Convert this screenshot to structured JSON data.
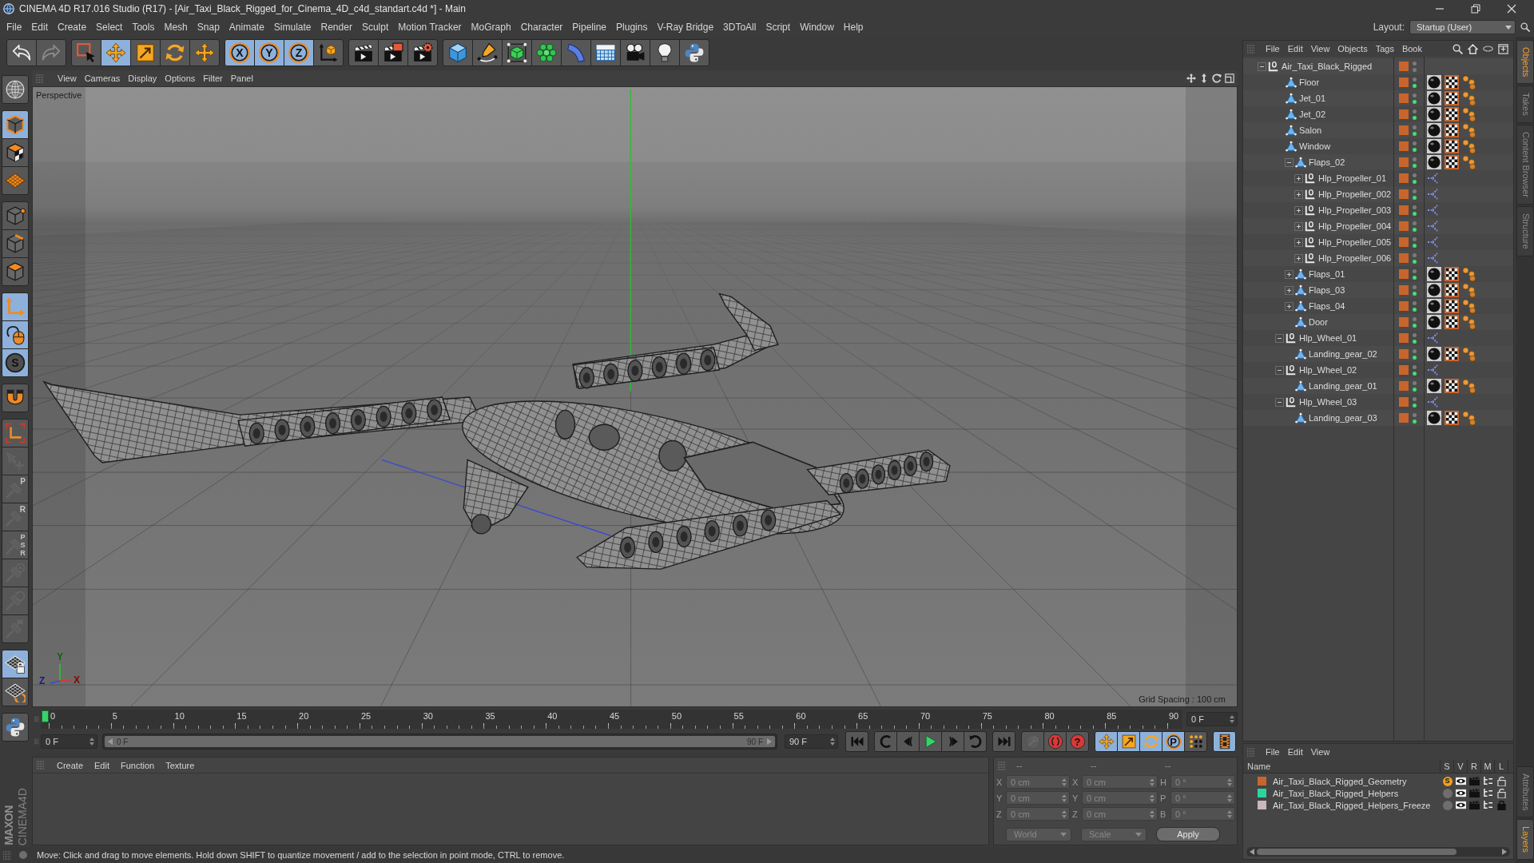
{
  "window": {
    "title": "CINEMA 4D R17.016 Studio (R17) - [Air_Taxi_Black_Rigged_for_Cinema_4D_c4d_standart.c4d *] - Main"
  },
  "menu_bar": [
    "File",
    "Edit",
    "Create",
    "Select",
    "Tools",
    "Mesh",
    "Snap",
    "Animate",
    "Simulate",
    "Render",
    "Sculpt",
    "Motion Tracker",
    "MoGraph",
    "Character",
    "Pipeline",
    "Plugins",
    "V-Ray Bridge",
    "3DToAll",
    "Script",
    "Window",
    "Help"
  ],
  "layout": {
    "label": "Layout:",
    "value": "Startup (User)"
  },
  "toolbar": [
    [
      {
        "selected": false,
        "disabled": false
      },
      {
        "selected": false,
        "disabled": true
      }
    ],
    [
      {
        "selected": false,
        "disabled": false
      },
      {
        "selected": true,
        "disabled": false
      },
      {
        "selected": false,
        "disabled": false
      },
      {
        "selected": false,
        "disabled": false
      },
      {
        "selected": false,
        "disabled": false
      }
    ],
    [
      {
        "label": "X",
        "selected": true,
        "disabled": false
      },
      {
        "label": "Y",
        "selected": true,
        "disabled": false
      },
      {
        "label": "Z",
        "selected": true,
        "disabled": false
      },
      {
        "selected": false,
        "disabled": false
      }
    ],
    [
      {
        "selected": false,
        "disabled": false
      },
      {
        "selected": false,
        "disabled": false
      },
      {
        "selected": false,
        "disabled": false
      }
    ],
    [
      {
        "selected": false,
        "disabled": false
      },
      {
        "selected": false,
        "disabled": false
      },
      {
        "selected": false,
        "disabled": false
      },
      {
        "selected": false,
        "disabled": false
      },
      {
        "selected": false,
        "disabled": false
      },
      {
        "selected": false,
        "disabled": false
      },
      {
        "selected": false,
        "disabled": false
      },
      {
        "selected": false,
        "disabled": false
      },
      {
        "selected": false,
        "disabled": false
      }
    ]
  ],
  "left_toolbar": [
    [
      {
        "selected": false,
        "disabled": false
      }
    ],
    [
      {
        "selected": true,
        "disabled": false
      },
      {
        "selected": false,
        "disabled": false
      },
      {
        "selected": false,
        "disabled": false
      }
    ],
    [
      {
        "selected": false,
        "disabled": false
      },
      {
        "selected": false,
        "disabled": false
      },
      {
        "selected": false,
        "disabled": false
      }
    ],
    [
      {
        "selected": true,
        "disabled": false
      },
      {
        "selected": true,
        "disabled": false
      },
      {
        "label": "S",
        "selected": true,
        "disabled": false
      }
    ],
    [
      {
        "selected": false,
        "disabled": false
      }
    ],
    [
      {
        "selected": false,
        "disabled": false
      },
      {
        "selected": false,
        "disabled": true
      },
      {
        "label": "P",
        "selected": false,
        "disabled": true
      },
      {
        "label": "R",
        "selected": false,
        "disabled": true
      },
      {
        "label": "PSR",
        "selected": false,
        "disabled": true
      },
      {
        "selected": false,
        "disabled": true
      },
      {
        "selected": false,
        "disabled": true
      },
      {
        "selected": false,
        "disabled": true
      }
    ],
    [
      {
        "selected": true,
        "disabled": false
      },
      {
        "selected": false,
        "disabled": false
      }
    ],
    [
      {
        "selected": false,
        "disabled": false
      }
    ]
  ],
  "viewport": {
    "menu": [
      "View",
      "Cameras",
      "Display",
      "Options",
      "Filter",
      "Panel"
    ],
    "camera": "Perspective",
    "axis_labels": [
      "Y",
      "Z",
      "X"
    ],
    "grid_spacing": "Grid Spacing : 100 cm"
  },
  "timeline": {
    "ticks": [
      "0",
      "5",
      "10",
      "15",
      "20",
      "25",
      "30",
      "35",
      "40",
      "45",
      "50",
      "55",
      "60",
      "65",
      "70",
      "75",
      "80",
      "85",
      "90"
    ],
    "level": 0,
    "current_frame": "0 F"
  },
  "transport": {
    "start_frame": "0 F",
    "range": {
      "start": "0 F",
      "end": "90 F",
      "level": 1
    },
    "end_frame": "90 F",
    "buttons": [
      [
        {
          "selected": false,
          "disabled": false
        }
      ],
      [
        {
          "selected": false,
          "disabled": false
        },
        {
          "selected": false,
          "disabled": false
        },
        {
          "selected": false,
          "disabled": false
        },
        {
          "selected": false,
          "disabled": false
        },
        {
          "selected": false,
          "disabled": false
        }
      ],
      [
        {
          "selected": false,
          "disabled": false
        }
      ],
      [
        {
          "selected": false,
          "disabled": true
        },
        {
          "selected": false,
          "disabled": false
        },
        {
          "label": "?",
          "selected": false,
          "disabled": false
        }
      ],
      [
        {
          "selected": true,
          "disabled": false
        },
        {
          "selected": true,
          "disabled": false
        },
        {
          "selected": true,
          "disabled": false
        },
        {
          "label": "P",
          "selected": true,
          "disabled": false
        },
        {
          "selected": false,
          "disabled": false
        }
      ],
      [
        {
          "selected": true,
          "disabled": false
        }
      ]
    ]
  },
  "material_manager": {
    "menu": [
      "Create",
      "Edit",
      "Function",
      "Texture"
    ]
  },
  "coordinates": {
    "disabled": true,
    "headers": [
      "--",
      "--",
      "--"
    ],
    "rows": [
      {
        "position_axis": "X",
        "position": "0 cm",
        "size_axis": "X",
        "size": "0 cm",
        "rotation_axis": "H",
        "rotation": "0 °"
      },
      {
        "position_axis": "Y",
        "position": "0 cm",
        "size_axis": "Y",
        "size": "0 cm",
        "rotation_axis": "P",
        "rotation": "0 °"
      },
      {
        "position_axis": "Z",
        "position": "0 cm",
        "size_axis": "Z",
        "size": "0 cm",
        "rotation_axis": "B",
        "rotation": "0 °"
      }
    ],
    "position_mode": "World",
    "size_mode": "Scale",
    "apply": "Apply"
  },
  "status_bar": {
    "message": "Move: Click and drag to move elements. Hold down SHIFT to quantize movement / add to the selection in point mode, CTRL to remove."
  },
  "object_manager": {
    "menu": [
      "File",
      "Edit",
      "View",
      "Objects",
      "Tags",
      "Book"
    ],
    "objects": [
      {
        "name": "Air_Taxi_Black_Rigged",
        "kind": "null",
        "expanded": true,
        "render_visible": false,
        "children": [
          {
            "name": "Floor",
            "kind": "mesh",
            "render_visible": true
          },
          {
            "name": "Jet_01",
            "kind": "mesh",
            "render_visible": true
          },
          {
            "name": "Jet_02",
            "kind": "mesh",
            "render_visible": true
          },
          {
            "name": "Salon",
            "kind": "mesh",
            "render_visible": true
          },
          {
            "name": "Window",
            "kind": "mesh",
            "render_visible": true,
            "children": [
              {
                "name": "Flaps_02",
                "kind": "mesh",
                "expanded": true,
                "render_visible": true,
                "children": [
                  {
                    "name": "Hlp_Propeller_01",
                    "kind": "helper",
                    "expanded": false,
                    "render_visible": true
                  },
                  {
                    "name": "Hlp_Propeller_002",
                    "kind": "helper",
                    "expanded": false,
                    "render_visible": true
                  },
                  {
                    "name": "Hlp_Propeller_003",
                    "kind": "helper",
                    "expanded": false,
                    "render_visible": true
                  },
                  {
                    "name": "Hlp_Propeller_004",
                    "kind": "helper",
                    "expanded": false,
                    "render_visible": true
                  },
                  {
                    "name": "Hlp_Propeller_005",
                    "kind": "helper",
                    "expanded": false,
                    "render_visible": true
                  },
                  {
                    "name": "Hlp_Propeller_006",
                    "kind": "helper",
                    "expanded": false,
                    "render_visible": true
                  }
                ]
              },
              {
                "name": "Flaps_01",
                "kind": "mesh",
                "expanded": false,
                "render_visible": true
              },
              {
                "name": "Flaps_03",
                "kind": "mesh",
                "expanded": false,
                "render_visible": true
              },
              {
                "name": "Flaps_04",
                "kind": "mesh",
                "expanded": false,
                "render_visible": true
              },
              {
                "name": "Door",
                "kind": "mesh",
                "render_visible": true
              }
            ]
          },
          {
            "name": "Hlp_Wheel_01",
            "kind": "helper",
            "expanded": true,
            "render_visible": true,
            "children": [
              {
                "name": "Landing_gear_02",
                "kind": "mesh",
                "render_visible": true
              }
            ]
          },
          {
            "name": "Hlp_Wheel_02",
            "kind": "helper",
            "expanded": true,
            "render_visible": true,
            "children": [
              {
                "name": "Landing_gear_01",
                "kind": "mesh",
                "render_visible": true
              }
            ]
          },
          {
            "name": "Hlp_Wheel_03",
            "kind": "helper",
            "expanded": true,
            "render_visible": true,
            "children": [
              {
                "name": "Landing_gear_03",
                "kind": "mesh",
                "render_visible": true
              }
            ]
          }
        ]
      }
    ]
  },
  "layer_manager": {
    "menu": [
      "File",
      "Edit",
      "View"
    ],
    "columns": [
      "Name",
      "S",
      "V",
      "R",
      "M",
      "L"
    ],
    "layers": [
      {
        "name": "Air_Taxi_Black_Rigged_Geometry",
        "color": "#c8652c",
        "solo": true,
        "solo_mark": "S",
        "visible": true,
        "render": true,
        "manager": true,
        "locked": false
      },
      {
        "name": "Air_Taxi_Black_Rigged_Helpers",
        "color": "#2ad69c",
        "solo": false,
        "visible": true,
        "render": true,
        "manager": true,
        "locked": false
      },
      {
        "name": "Air_Taxi_Black_Rigged_Helpers_Freeze",
        "color": "#c9b6c1",
        "solo": false,
        "visible": true,
        "render": true,
        "manager": true,
        "locked": true
      }
    ]
  },
  "side_tabs_top": [
    {
      "label": "Objects",
      "selected": true
    },
    {
      "label": "Takes",
      "selected": false
    },
    {
      "label": "Content Browser",
      "selected": false
    },
    {
      "label": "Structure",
      "selected": false
    }
  ],
  "side_tabs_bottom": [
    {
      "label": "Attributes",
      "selected": false
    },
    {
      "label": "Layers",
      "selected": true
    }
  ],
  "brand": {
    "company": "MAXON",
    "product": "CINEMA4D"
  }
}
